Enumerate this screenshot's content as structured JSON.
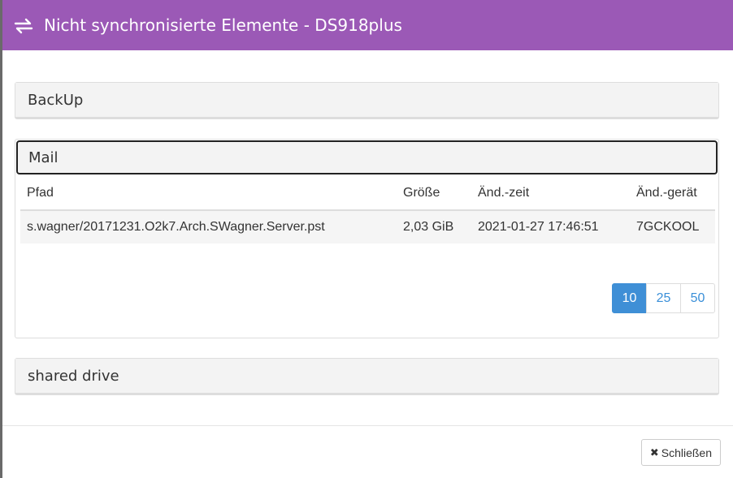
{
  "dialog": {
    "title": "Nicht synchronisierte Elemente - DS918plus",
    "header_icon": "exchange-arrows-icon",
    "colors": {
      "header": "#9b59b6",
      "pager_active": "#3f8fd6"
    }
  },
  "panels": {
    "backup": {
      "label": "BackUp"
    },
    "mail": {
      "label": "Mail",
      "table": {
        "headers": [
          "Pfad",
          "Größe",
          "Änd.-zeit",
          "Änd.-gerät"
        ],
        "rows": [
          [
            "s.wagner/20171231.O2k7.Arch.SWagner.Server.pst",
            "2,03 GiB",
            "2021-01-27 17:46:51",
            "7GCKOOL"
          ]
        ]
      },
      "pager": {
        "options": [
          "10",
          "25",
          "50"
        ],
        "selected": "10"
      }
    },
    "shared": {
      "label": "shared drive"
    }
  },
  "footer": {
    "close_label": "Schließen",
    "close_icon": "close-x-icon"
  }
}
